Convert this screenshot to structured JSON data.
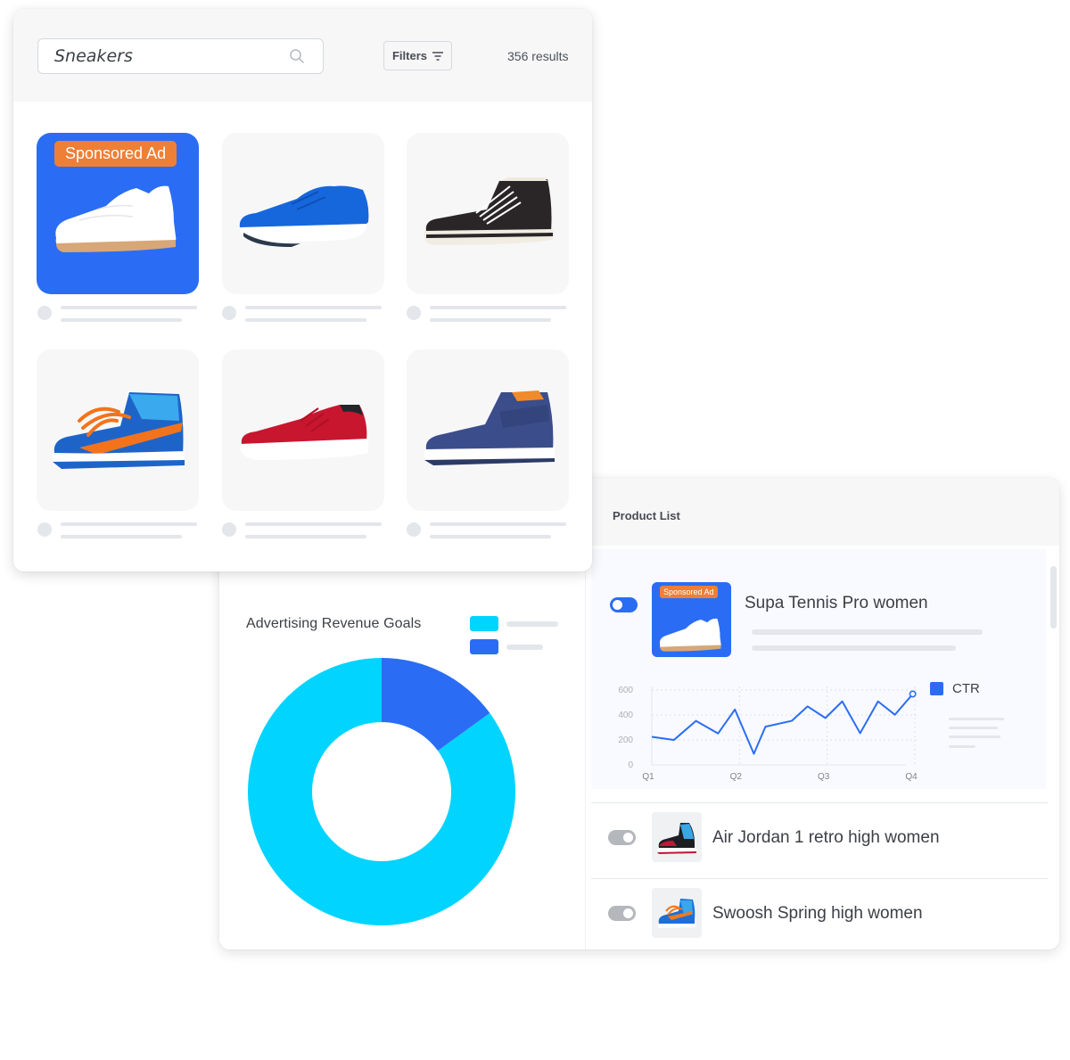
{
  "search": {
    "query": "Sneakers",
    "filters_label": "Filters",
    "results_text": "356 results"
  },
  "products": [
    {
      "name": "white-classic-sneaker",
      "sponsored": true,
      "badge": "Sponsored Ad"
    },
    {
      "name": "blue-running-shoe",
      "sponsored": false
    },
    {
      "name": "black-canvas-high-top",
      "sponsored": false
    },
    {
      "name": "blue-orange-high-top",
      "sponsored": false
    },
    {
      "name": "red-knit-sneaker",
      "sponsored": false
    },
    {
      "name": "navy-strap-high-top",
      "sponsored": false
    }
  ],
  "colors": {
    "accent_blue": "#2a6df4",
    "cyan": "#00d4ff",
    "badge_orange": "#ee7f37"
  },
  "revenue": {
    "title": "Advertising Revenue Goals"
  },
  "product_list": {
    "title": "Product List",
    "rows": [
      {
        "name": "Supa Tennis Pro women",
        "enabled": true,
        "badge": "Sponsored Ad",
        "expanded": true
      },
      {
        "name": "Air Jordan 1 retro high women",
        "enabled": false,
        "expanded": false
      },
      {
        "name": "Swoosh Spring high women",
        "enabled": false,
        "expanded": false
      }
    ]
  },
  "chart_data": [
    {
      "type": "pie",
      "title": "Advertising Revenue Goals",
      "donut": true,
      "legend": "top-right",
      "slices": [
        {
          "name": "",
          "value": 85,
          "color": "#00d4ff"
        },
        {
          "name": "",
          "value": 15,
          "color": "#2a6df4"
        }
      ]
    },
    {
      "type": "line",
      "title": "",
      "legend": "right",
      "categories": [
        "Q1",
        "Q2",
        "Q3",
        "Q4"
      ],
      "x": [
        0,
        0.21,
        0.42,
        0.63,
        0.79,
        0.97,
        1.08,
        1.33,
        1.48,
        1.65,
        1.81,
        1.98,
        2.15,
        2.31,
        2.48
      ],
      "series": [
        {
          "name": "CTR",
          "color": "#2a6df4",
          "values": [
            225,
            200,
            353,
            252,
            444,
            89,
            306,
            353,
            469,
            376,
            509,
            254,
            509,
            402,
            568
          ]
        }
      ],
      "yticks": [
        0,
        200,
        400,
        600
      ],
      "ylim": [
        0,
        600
      ],
      "xlim": [
        0,
        2.5
      ],
      "grid": true
    }
  ]
}
